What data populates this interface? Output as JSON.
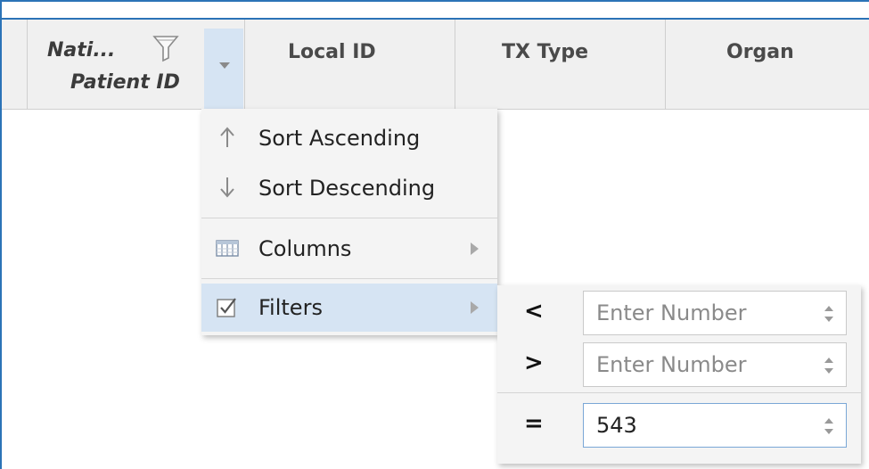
{
  "grid": {
    "columns": [
      {
        "label_line1": "Nati...",
        "label_line2": "Patient ID",
        "has_filter": true,
        "has_menu": true
      },
      {
        "label": "Local ID"
      },
      {
        "label": "TX Type"
      },
      {
        "label": "Organ"
      }
    ]
  },
  "column_menu": {
    "items": [
      {
        "label": "Sort Ascending",
        "icon": "arrow-up-icon"
      },
      {
        "label": "Sort Descending",
        "icon": "arrow-down-icon"
      },
      {
        "label": "Columns",
        "icon": "columns-icon",
        "submenu": true
      },
      {
        "label": "Filters",
        "icon": "checkbox-checked-icon",
        "submenu": true,
        "active": true
      }
    ]
  },
  "filters_submenu": {
    "rows": [
      {
        "operator": "<",
        "value": "",
        "placeholder": "Enter Number"
      },
      {
        "operator": ">",
        "value": "",
        "placeholder": "Enter Number"
      },
      {
        "operator": "=",
        "value": "543",
        "placeholder": "Enter Number"
      }
    ]
  },
  "colors": {
    "frame_border": "#2b73b7",
    "header_bg": "#f0f0f0",
    "active_menu_bg": "#d6e4f3",
    "menu_bg": "#f4f4f4"
  }
}
